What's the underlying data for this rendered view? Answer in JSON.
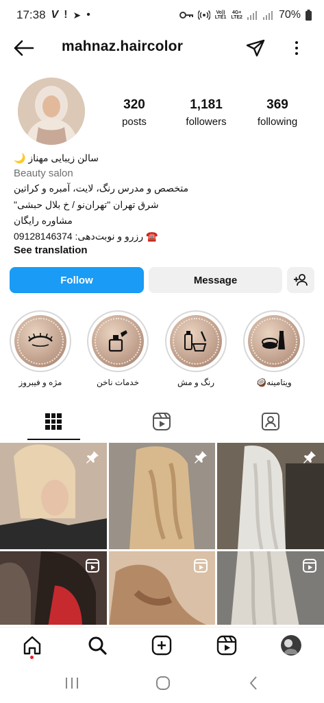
{
  "status_bar": {
    "time": "17:38",
    "left_glyphs": [
      "V",
      "!",
      "➤",
      "•"
    ],
    "net_top": "Vo))",
    "net_bottom": "LTE1",
    "net2_top": "4G+",
    "net2_bottom": "LTE2",
    "battery": "70%"
  },
  "header": {
    "username": "mahnaz.haircolor"
  },
  "profile": {
    "stats": [
      {
        "value": "320",
        "label": "posts"
      },
      {
        "value": "1,181",
        "label": "followers"
      },
      {
        "value": "369",
        "label": "following"
      }
    ],
    "bio": {
      "name": "سالن زیبایی مهناز 🌙",
      "category": "Beauty salon",
      "line1": "متخصص و مدرس رنگ، لایت، آمبره و کراتین",
      "line2": "شرق تهران \"تهران‌نو / خ بلال حبشی\"",
      "line3": "مشاوره رایگان",
      "line4": "☎️ رزرو و نوبت‌دهی: 09128146374",
      "see_translation": "See translation"
    }
  },
  "actions": {
    "follow": "Follow",
    "message": "Message"
  },
  "highlights": [
    {
      "label": "مژه و فیبروز",
      "icon": "eyelash-icon"
    },
    {
      "label": "خدمات ناخن",
      "icon": "nail-polish-icon"
    },
    {
      "label": "رنگ و مش",
      "icon": "hair-dye-icon"
    },
    {
      "label": "ویتامینه🥥",
      "icon": "cosmetics-icon"
    }
  ],
  "tabs": [
    {
      "name": "grid-icon",
      "active": true
    },
    {
      "name": "reels-icon",
      "active": false
    },
    {
      "name": "tagged-icon",
      "active": false
    }
  ],
  "colors": {
    "follow": "#1a9bf5",
    "secondary_button": "#f0f0f0",
    "category": "#6f6f6f"
  }
}
